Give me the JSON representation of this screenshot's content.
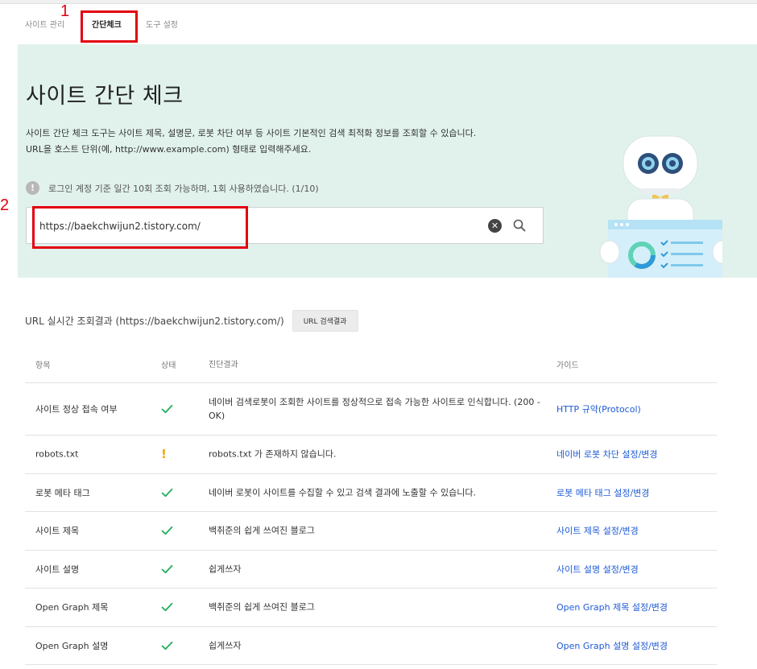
{
  "tabs": [
    {
      "label": "사이트 관리"
    },
    {
      "label": "간단체크"
    },
    {
      "label": "도구 설정"
    }
  ],
  "annotations": {
    "mark1": "1",
    "mark2": "2"
  },
  "hero": {
    "title": "사이트 간단 체크",
    "desc_line1": "사이트 간단 체크 도구는 사이트 제목, 설명문, 로봇 차단 여부 등 사이트 기본적인 검색 최적화 정보를 조회할 수 있습니다.",
    "desc_line2": "URL을 호스트 단위(예, http://www.example.com) 형태로 입력해주세요.",
    "notice": "로그인 계정 기준 일간 10회 조회 가능하며, 1회 사용하였습니다. (1/10)",
    "search_value": "https://baekchwijun2.tistory.com/"
  },
  "result": {
    "title": "URL 실시간 조회결과 (https://baekchwijun2.tistory.com/)",
    "button_label": "URL 검색결과"
  },
  "table": {
    "headers": {
      "item": "항목",
      "status": "상태",
      "result": "진단결과",
      "guide": "가이드"
    },
    "rows": [
      {
        "item": "사이트 정상 접속 여부",
        "status": "ok",
        "result": "네이버 검색로봇이 조회한 사이트를 정상적으로 접속 가능한 사이트로 인식합니다. (200 - OK)",
        "guide": "HTTP 규약(Protocol)"
      },
      {
        "item": "robots.txt",
        "status": "warning",
        "status_text": "!",
        "result": "robots.txt 가 존재하지 않습니다.",
        "guide": "네이버 로봇 차단 설정/변경"
      },
      {
        "item": "로봇 메타 태그",
        "status": "ok",
        "result": "네이버 로봇이 사이트를 수집할 수 있고 검색 결과에 노출할 수 있습니다.",
        "guide": "로봇 메타 태그 설정/변경"
      },
      {
        "item": "사이트 제목",
        "status": "ok",
        "result": "백취준의 쉽게 쓰여진 블로그",
        "guide": "사이트 제목 설정/변경"
      },
      {
        "item": "사이트 설명",
        "status": "ok",
        "result": "쉽게쓰자",
        "guide": "사이트 설명 설정/변경"
      },
      {
        "item": "Open Graph 제목",
        "status": "ok",
        "result": "백취준의 쉽게 쓰여진 블로그",
        "guide": "Open Graph 제목 설정/변경"
      },
      {
        "item": "Open Graph 설명",
        "status": "ok",
        "result": "쉽게쓰자",
        "guide": "Open Graph 설명 설정/변경"
      }
    ]
  },
  "colors": {
    "hero_bg": "#e1f2ec",
    "check_green": "#1fae5b",
    "warning": "#f4a600",
    "link_blue": "#1f5bd6",
    "highlight_red": "#e3000f"
  }
}
